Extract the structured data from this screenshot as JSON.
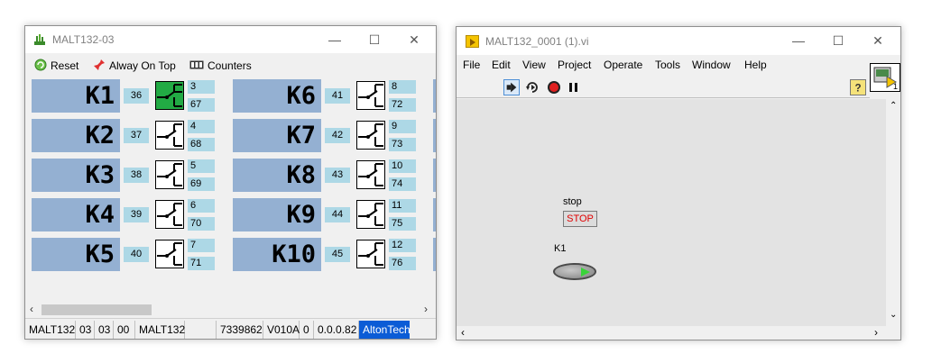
{
  "window1": {
    "title": "MALT132-03",
    "controls": {
      "minimize": "—",
      "maximize": "☐",
      "close": "✕"
    },
    "menu": [
      {
        "label": "Reset",
        "icon": "reset-icon"
      },
      {
        "label": "Alway On Top",
        "icon": "pin-icon"
      },
      {
        "label": "Counters",
        "icon": "counters-icon"
      }
    ],
    "relays": [
      {
        "label": "K1",
        "left_num": "36",
        "top_num": "3",
        "bottom_num": "67",
        "state": "on"
      },
      {
        "label": "K2",
        "left_num": "37",
        "top_num": "4",
        "bottom_num": "68",
        "state": "off"
      },
      {
        "label": "K3",
        "left_num": "38",
        "top_num": "5",
        "bottom_num": "69",
        "state": "off"
      },
      {
        "label": "K4",
        "left_num": "39",
        "top_num": "6",
        "bottom_num": "70",
        "state": "off"
      },
      {
        "label": "K5",
        "left_num": "40",
        "top_num": "7",
        "bottom_num": "71",
        "state": "off"
      },
      {
        "label": "K6",
        "left_num": "41",
        "top_num": "8",
        "bottom_num": "72",
        "state": "off"
      },
      {
        "label": "K7",
        "left_num": "42",
        "top_num": "9",
        "bottom_num": "73",
        "state": "off"
      },
      {
        "label": "K8",
        "left_num": "43",
        "top_num": "10",
        "bottom_num": "74",
        "state": "off"
      },
      {
        "label": "K9",
        "left_num": "44",
        "top_num": "11",
        "bottom_num": "75",
        "state": "off"
      },
      {
        "label": "K10",
        "left_num": "45",
        "top_num": "12",
        "bottom_num": "76",
        "state": "off"
      }
    ],
    "status": [
      "MALT132",
      "03",
      "03",
      "00",
      "MALT132",
      "",
      "7339862",
      "V010A",
      "0",
      "0.0.0.82",
      "AltonTech"
    ],
    "colors": {
      "relay_label_bg": "#94b0d2",
      "number_bg": "#add8e6",
      "relay_on": "#22aa44",
      "brand_bg": "#0b5cd6"
    }
  },
  "window2": {
    "title": "MALT132_0001 (1).vi",
    "controls": {
      "minimize": "—",
      "maximize": "☐",
      "close": "✕"
    },
    "menu": [
      "File",
      "Edit",
      "View",
      "Project",
      "Operate",
      "Tools",
      "Window",
      "Help"
    ],
    "toolbar": [
      "run-icon",
      "run-continuously-icon",
      "abort-icon",
      "pause-icon",
      "help-icon"
    ],
    "vi_icon_number": "1",
    "stop_label": "stop",
    "stop_button": "STOP",
    "led_label": "K1",
    "colors": {
      "panel_bg": "#e3e3e3",
      "stop_text": "#e00000"
    }
  }
}
